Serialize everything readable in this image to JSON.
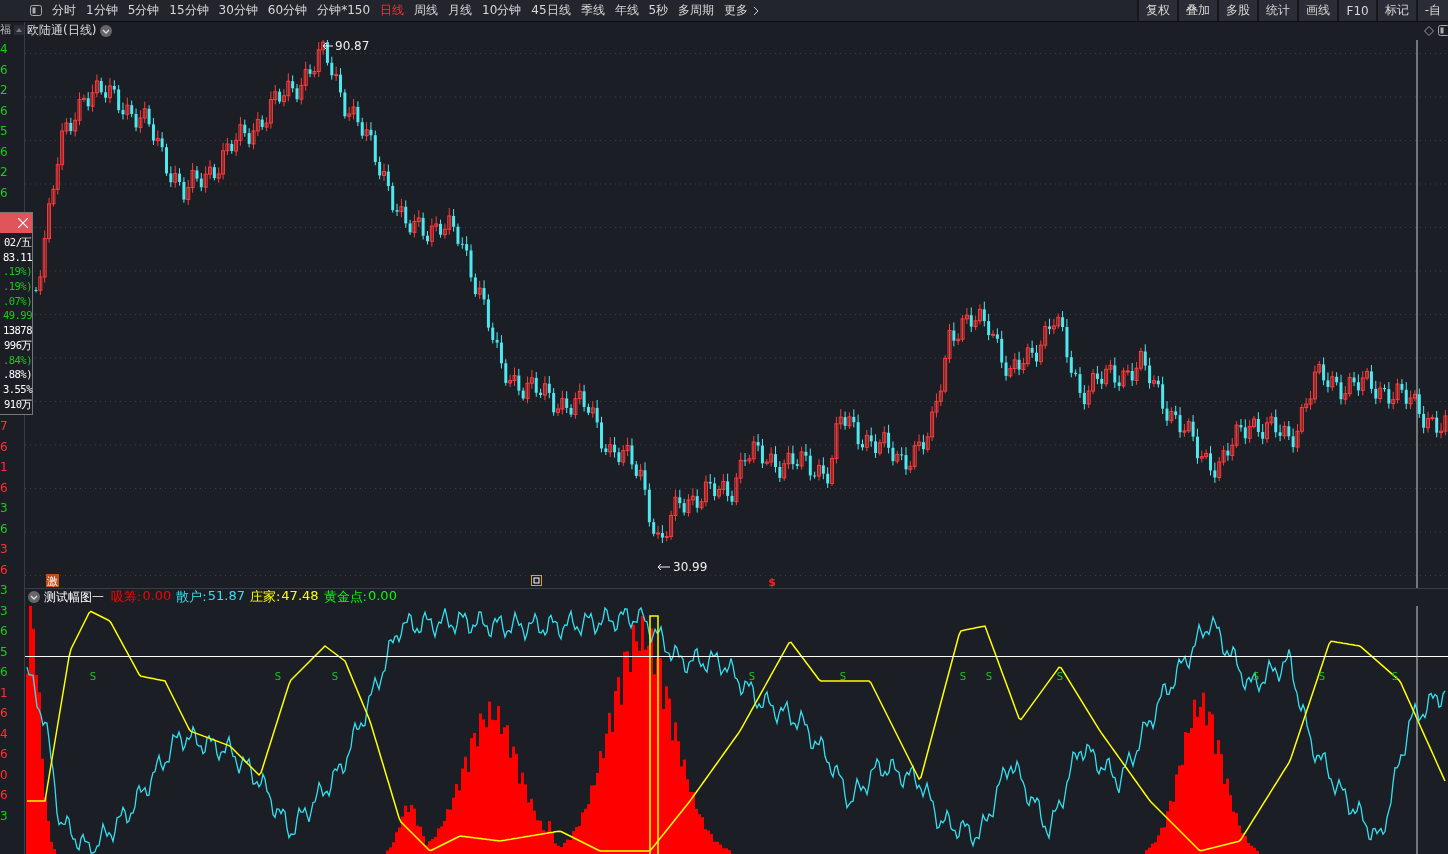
{
  "toolbar": {
    "periods": [
      {
        "label": "分时",
        "selected": false
      },
      {
        "label": "1分钟",
        "selected": false
      },
      {
        "label": "5分钟",
        "selected": false
      },
      {
        "label": "15分钟",
        "selected": false
      },
      {
        "label": "30分钟",
        "selected": false
      },
      {
        "label": "60分钟",
        "selected": false
      },
      {
        "label": "分钟*150",
        "selected": false
      },
      {
        "label": "日线",
        "selected": true
      },
      {
        "label": "周线",
        "selected": false
      },
      {
        "label": "月线",
        "selected": false
      },
      {
        "label": "10分钟",
        "selected": false
      },
      {
        "label": "45日线",
        "selected": false
      },
      {
        "label": "季线",
        "selected": false
      },
      {
        "label": "年线",
        "selected": false
      },
      {
        "label": "5秒",
        "selected": false
      },
      {
        "label": "多周期",
        "selected": false
      }
    ],
    "more": "更多",
    "buttons": [
      "复权",
      "叠加",
      "多股",
      "统计",
      "画线",
      "F10",
      "标记",
      "-自"
    ]
  },
  "axis": {
    "side_label": "福",
    "upper_labels": [
      {
        "text": "4",
        "color": "#1ec81e"
      },
      {
        "text": "6",
        "color": "#1ec81e"
      },
      {
        "text": "2",
        "color": "#1ec81e"
      },
      {
        "text": "6",
        "color": "#1ec81e"
      },
      {
        "text": "5",
        "color": "#1ec81e"
      },
      {
        "text": "6",
        "color": "#1ec81e"
      },
      {
        "text": "2",
        "color": "#1ec81e"
      },
      {
        "text": "6",
        "color": "#1ec81e"
      }
    ],
    "lower_labels": [
      {
        "text": "7",
        "color": "#ff3232"
      },
      {
        "text": "6",
        "color": "#ff3232"
      },
      {
        "text": "1",
        "color": "#ff3232"
      },
      {
        "text": "6",
        "color": "#ff3232"
      },
      {
        "text": "3",
        "color": "#1ec81e"
      },
      {
        "text": "6",
        "color": "#1ec81e"
      },
      {
        "text": "3",
        "color": "#ff3232"
      },
      {
        "text": "6",
        "color": "#ff3232"
      },
      {
        "text": "3",
        "color": "#1ec81e"
      },
      {
        "text": "3",
        "color": "#1ec81e"
      },
      {
        "text": "6",
        "color": "#1ec81e"
      },
      {
        "text": "5",
        "color": "#1ec81e"
      },
      {
        "text": "6",
        "color": "#1ec81e"
      },
      {
        "text": "1",
        "color": "#ff3232"
      },
      {
        "text": "6",
        "color": "#ff3232"
      },
      {
        "text": "4",
        "color": "#ff3232"
      },
      {
        "text": "6",
        "color": "#ff3232"
      },
      {
        "text": "0",
        "color": "#ff3232"
      },
      {
        "text": "6",
        "color": "#ff3232"
      },
      {
        "text": "3",
        "color": "#1ec81e"
      }
    ]
  },
  "info_popup": {
    "rows": [
      {
        "text": "02/五",
        "color": "#ffffff"
      },
      {
        "text": "83.11",
        "color": "#ffffff"
      },
      {
        "text": ".19%)",
        "color": "#1ec81e"
      },
      {
        "text": ".19%)",
        "color": "#1ec81e"
      },
      {
        "text": ".07%)",
        "color": "#1ec81e"
      },
      {
        "text": "49.99",
        "color": "#1ec81e"
      },
      {
        "text": "13878",
        "color": "#ffffff"
      },
      {
        "text": "996万",
        "color": "#ffffff"
      },
      {
        "text": ".84%)",
        "color": "#1ec81e"
      },
      {
        "text": ".88%)",
        "color": "#ffffff"
      },
      {
        "text": "3.55%",
        "color": "#ffffff"
      },
      {
        "text": "910万",
        "color": "#ffffff"
      }
    ]
  },
  "chart": {
    "title": "欧陆通(日线)",
    "high_label": "90.87",
    "low_label": "30.99",
    "event_badge": "激",
    "signal_mark": "$"
  },
  "indicator": {
    "name": "测试幅图一",
    "values": [
      {
        "label": "吸筹:",
        "value": "0.00",
        "color": "#ff0000"
      },
      {
        "label": "散户:",
        "value": "51.87",
        "color": "#33e0f0"
      },
      {
        "label": "庄家:",
        "value": "47.48",
        "color": "#ffff00"
      },
      {
        "label": "黄金点:",
        "value": "0.00",
        "color": "#00ff00"
      }
    ],
    "markers": [
      {
        "text": "S"
      },
      {
        "text": "S"
      },
      {
        "text": "S"
      },
      {
        "text": "S"
      },
      {
        "text": "S"
      },
      {
        "text": "S"
      },
      {
        "text": "S"
      },
      {
        "text": "S"
      },
      {
        "text": "S"
      },
      {
        "text": "S"
      },
      {
        "text": "S"
      }
    ]
  }
}
